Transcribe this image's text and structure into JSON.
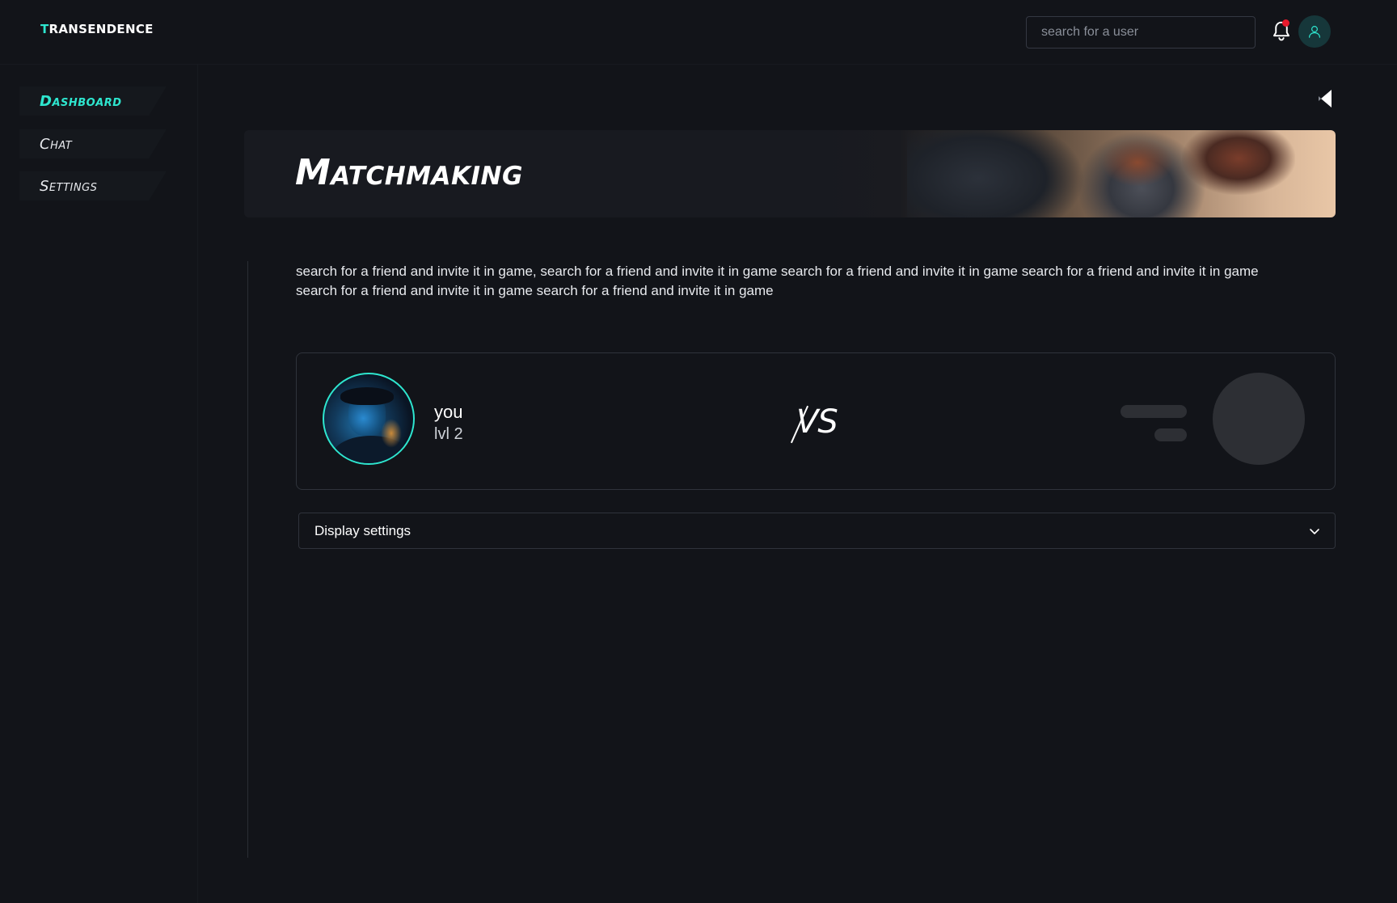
{
  "app": {
    "logo_accent": "T",
    "logo_rest": "RANSENDENCE",
    "accent_color": "#2ee6cf",
    "notification_dot_color": "#e8192c"
  },
  "header": {
    "search_placeholder": "search for a user",
    "icons": [
      "bell-icon",
      "user-icon"
    ]
  },
  "sidebar": {
    "items": [
      {
        "label": "Dashboard",
        "active": true
      },
      {
        "label": "Chat",
        "active": false
      },
      {
        "label": "Settings",
        "active": false
      }
    ]
  },
  "main": {
    "title": "Matchmaking",
    "description": "search for a friend and invite it in game, search for a friend and invite it in game search for a friend and invite it in game search for a friend and invite it in game search for a friend and invite it in game search for a friend and invite it in game",
    "match": {
      "player_name": "you",
      "player_level": "lvl 2",
      "vs_label": "VS"
    },
    "display_settings_label": "Display settings"
  }
}
